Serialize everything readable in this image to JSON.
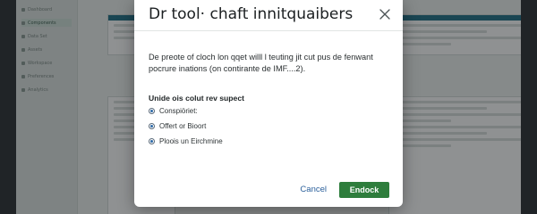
{
  "modal": {
    "title": "Dr tool· chaft innitquaibers",
    "description": "De preote of cloch lon qqet willl l teuting jit cut pus de fenwant pocrure inations (on contirante de IMF....2).",
    "section_label": "Unide ois colut rev supect",
    "options": [
      {
        "label": "Conspiöriet:",
        "selected": true
      },
      {
        "label": "Offert or Bioort",
        "selected": true
      },
      {
        "label": "Ploois un Eirchmine",
        "selected": true
      }
    ],
    "cancel_label": "Cancel",
    "confirm_label": "Endock",
    "close_icon": "close-icon"
  },
  "background": {
    "sidebar_items": [
      "Dashboard",
      "Components",
      "Data Set",
      "Assets",
      "Workspace",
      "Preferences",
      "Analytics"
    ],
    "colors": {
      "accent": "#1f6f86",
      "confirm": "#2e7d3c",
      "link": "#2a5f9b"
    }
  }
}
